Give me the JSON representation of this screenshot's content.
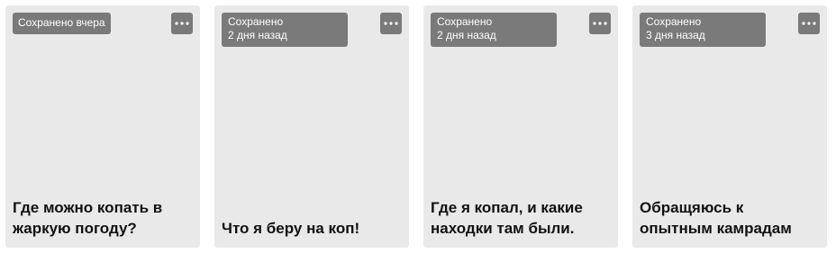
{
  "cards": [
    {
      "saved_label": "Сохранено вчера",
      "saved_when": "",
      "title": "Где можно копать в жаркую погоду?"
    },
    {
      "saved_label": "Сохранено",
      "saved_when": "2 дня назад",
      "title": "Что я беру на коп!"
    },
    {
      "saved_label": "Сохранено",
      "saved_when": "2 дня назад",
      "title": "Где я копал, и какие находки там были."
    },
    {
      "saved_label": "Сохранено",
      "saved_when": "3 дня назад",
      "title": "Обращяюсь к опытным камрадам"
    }
  ],
  "menu_icon": "more-dots-icon",
  "colors": {
    "card_bg": "#e9e9e9",
    "badge_bg": "#7a7a7a",
    "badge_text": "#ffffff",
    "title_text": "#111111"
  }
}
